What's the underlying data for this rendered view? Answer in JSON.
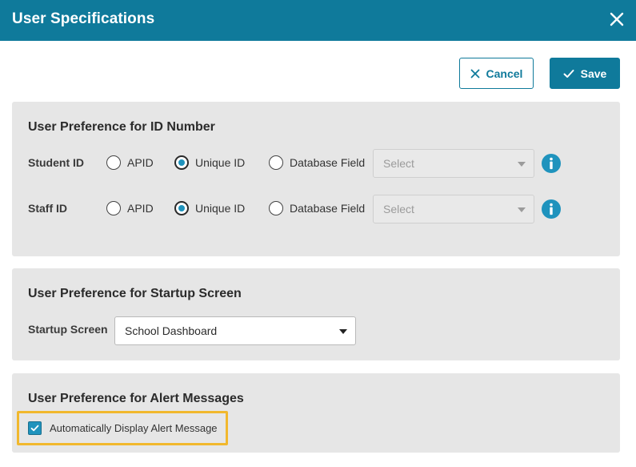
{
  "dialog": {
    "title": "User Specifications",
    "close_icon": "close-icon"
  },
  "actions": {
    "cancel_label": "Cancel",
    "cancel_icon": "x-icon",
    "save_label": "Save",
    "save_icon": "check-icon"
  },
  "id_section": {
    "title": "User Preference for ID Number",
    "rows": [
      {
        "label": "Student ID",
        "options": [
          "APID",
          "Unique ID",
          "Database Field"
        ],
        "selected": "Unique ID",
        "select_placeholder": "Select",
        "info_icon": "info-icon"
      },
      {
        "label": "Staff ID",
        "options": [
          "APID",
          "Unique ID",
          "Database Field"
        ],
        "selected": "Unique ID",
        "select_placeholder": "Select",
        "info_icon": "info-icon"
      }
    ]
  },
  "startup_section": {
    "title": "User Preference for Startup Screen",
    "label": "Startup Screen",
    "selected_value": "School Dashboard"
  },
  "alert_section": {
    "title": "User Preference for Alert Messages",
    "checkbox_label": "Automatically Display Alert Message",
    "checked": true
  },
  "colors": {
    "header": "#0f7a9b",
    "accent": "#1f93bd",
    "highlight": "#f1b82d",
    "panel": "#e6e6e6"
  }
}
